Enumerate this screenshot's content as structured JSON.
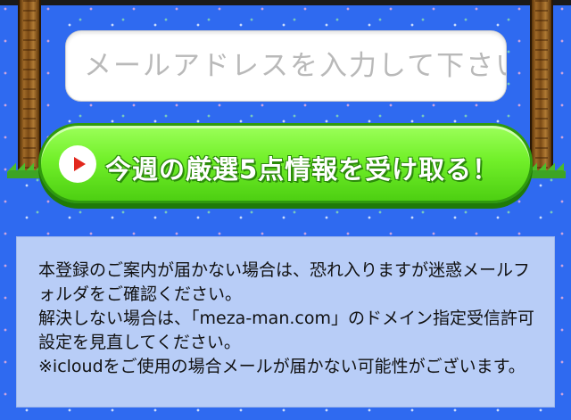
{
  "form": {
    "email_placeholder": "メールアドレスを入力して下さい",
    "email_value": "",
    "submit_label": "今週の厳選5点情報を受け取る！",
    "submit_icon": "play-icon"
  },
  "notice": {
    "text": "本登録のご案内が届かない場合は、恐れ入りますが迷惑メールフォルダをご確認ください。\n解決しない場合は、「meza-man.com」のドメイン指定受信許可設定を見直してください。\n※icloudをご使用の場合メールが届かない可能性がございます。"
  },
  "colors": {
    "background": "#2f6af0",
    "button_green": "#72f02a",
    "play_red": "#e2281d",
    "notice_bg": "#b8cdf7"
  }
}
